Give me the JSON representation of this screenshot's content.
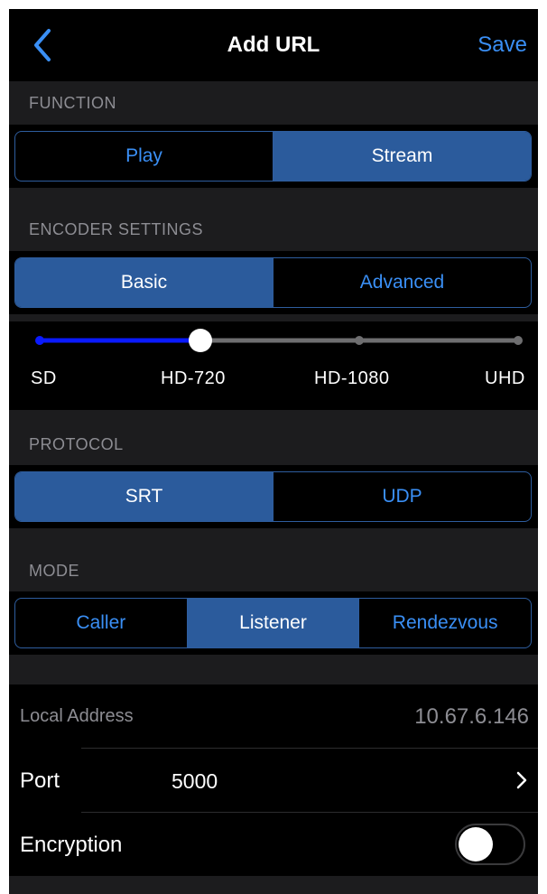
{
  "nav": {
    "title": "Add URL",
    "save_label": "Save",
    "back_icon": "chevron-left-icon"
  },
  "function": {
    "header": "FUNCTION",
    "options": [
      "Play",
      "Stream"
    ],
    "selected": "Stream"
  },
  "encoder": {
    "header": "ENCODER SETTINGS",
    "tabs": [
      "Basic",
      "Advanced"
    ],
    "selected_tab": "Basic",
    "quality_levels": [
      "SD",
      "HD-720",
      "HD-1080",
      "UHD"
    ],
    "selected_level": "HD-720",
    "slider_value_index": 1
  },
  "protocol": {
    "header": "PROTOCOL",
    "options": [
      "SRT",
      "UDP"
    ],
    "selected": "SRT"
  },
  "mode": {
    "header": "MODE",
    "options": [
      "Caller",
      "Listener",
      "Rendezvous"
    ],
    "selected": "Listener"
  },
  "settings": {
    "local_address_label": "Local Address",
    "local_address_value": "10.67.6.146",
    "port_label": "Port",
    "port_value": "5000",
    "encryption_label": "Encryption",
    "encryption_enabled": false
  },
  "colors": {
    "accent": "#3a8ff5",
    "segment_active": "#2b5b9c",
    "slider_fill": "#0a1aff",
    "slider_track": "#6e6e70",
    "background": "#1c1c1e"
  }
}
